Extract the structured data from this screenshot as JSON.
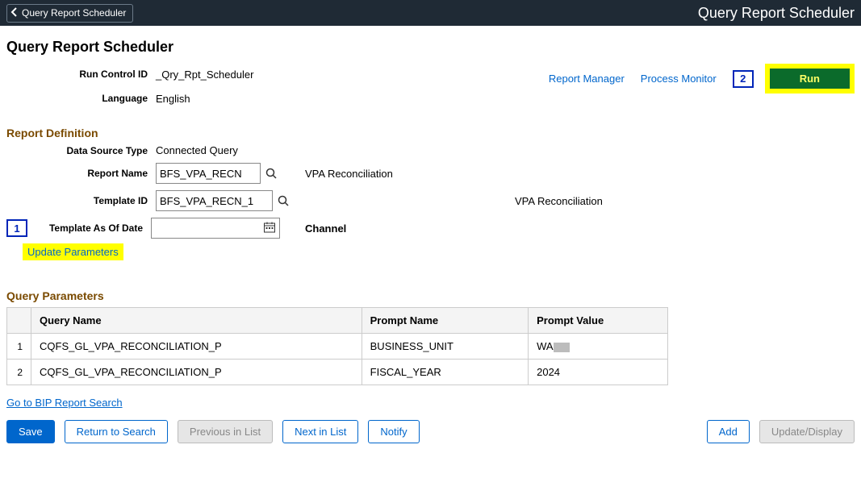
{
  "banner": {
    "back_label": "Query Report Scheduler",
    "title": "Query Report Scheduler"
  },
  "page": {
    "title": "Query Report Scheduler"
  },
  "meta": {
    "run_control_label": "Run Control ID",
    "run_control_value": "_Qry_Rpt_Scheduler",
    "language_label": "Language",
    "language_value": "English"
  },
  "links": {
    "report_manager": "Report Manager",
    "process_monitor": "Process Monitor"
  },
  "callouts": {
    "one": "1",
    "two": "2"
  },
  "run_button": "Run",
  "report_def": {
    "header": "Report Definition",
    "data_source_type_label": "Data Source Type",
    "data_source_type_value": "Connected Query",
    "report_name_label": "Report Name",
    "report_name_value": "BFS_VPA_RECN",
    "report_name_desc": "VPA Reconciliation",
    "template_id_label": "Template ID",
    "template_id_value": "BFS_VPA_RECN_1",
    "template_id_desc": "VPA Reconciliation",
    "asof_label": "Template As Of Date",
    "asof_value": "",
    "channel_label": "Channel",
    "update_parameters": "Update Parameters"
  },
  "query_params": {
    "header": "Query Parameters",
    "cols": {
      "query_name": "Query Name",
      "prompt_name": "Prompt Name",
      "prompt_value": "Prompt Value"
    },
    "rows": [
      {
        "idx": "1",
        "query_name": "CQFS_GL_VPA_RECONCILIATION_P",
        "prompt_name": "BUSINESS_UNIT",
        "prompt_value": "WA"
      },
      {
        "idx": "2",
        "query_name": "CQFS_GL_VPA_RECONCILIATION_P",
        "prompt_name": "FISCAL_YEAR",
        "prompt_value": "2024"
      }
    ]
  },
  "bottom": {
    "bip_search": "Go to BIP Report Search",
    "save": "Save",
    "return": "Return to Search",
    "prev": "Previous in List",
    "next": "Next in List",
    "notify": "Notify",
    "add": "Add",
    "update": "Update/Display"
  }
}
